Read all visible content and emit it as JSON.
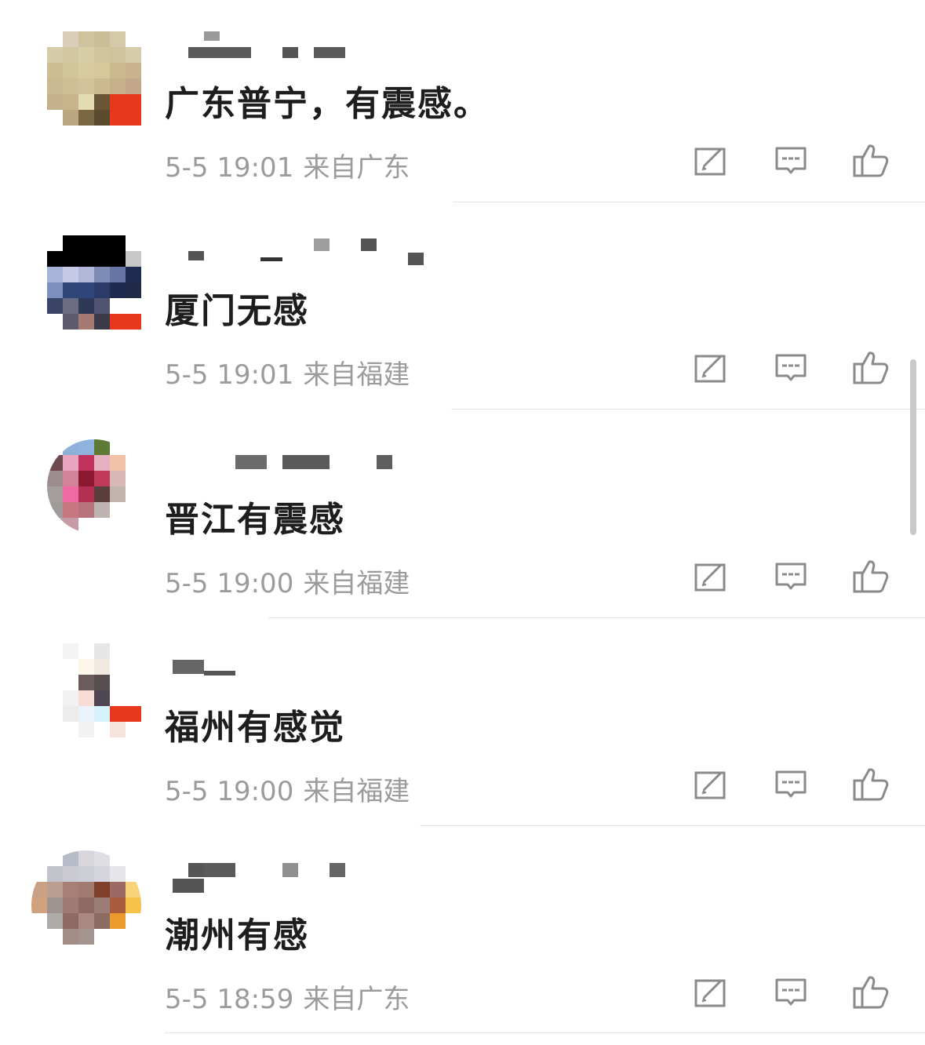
{
  "comments": [
    {
      "text": "广东普宁，有震感。",
      "time": "5-5 19:01",
      "location": "来自广东"
    },
    {
      "text": "厦门无感",
      "time": "5-5 19:01",
      "location": "来自福建"
    },
    {
      "text": "晋江有震感",
      "time": "5-5 19:00",
      "location": "来自福建"
    },
    {
      "text": "福州有感觉",
      "time": "5-5 19:00",
      "location": "来自福建"
    },
    {
      "text": "潮州有感",
      "time": "5-5 18:59",
      "location": "来自广东"
    }
  ],
  "icons": {
    "forward": "share-forward-icon",
    "reply": "reply-comment-icon",
    "like": "thumbs-up-icon"
  },
  "colors": {
    "text": "#1d1d1d",
    "meta": "#9b9b9b",
    "icon": "#8a8a8a",
    "divider": "#e6e6e6"
  }
}
